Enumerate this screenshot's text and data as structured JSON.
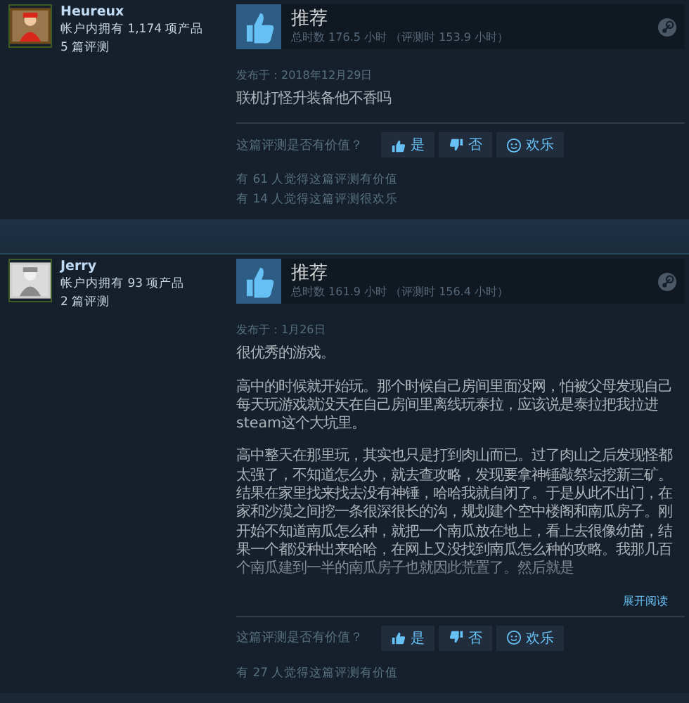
{
  "reviews": [
    {
      "author": "Heureux",
      "products": "帐户内拥有 1,174 项产品",
      "review_count": "5 篇评测",
      "recommended": true,
      "verdict": "推荐",
      "hours": "总时数 176.5 小时 （评测时 153.9 小时）",
      "posted": "发布于：2018年12月29日",
      "paragraphs": [
        "联机打怪升装备他不香吗"
      ],
      "truncated": false,
      "prompt": "这篇评测是否有价值？",
      "votes": [
        {
          "kind": "yes",
          "label": "是"
        },
        {
          "kind": "no",
          "label": "否"
        },
        {
          "kind": "funny",
          "label": "欢乐"
        }
      ],
      "stats": [
        "有 61 人觉得这篇评测有价值",
        "有 14 人觉得这篇评测很欢乐"
      ]
    },
    {
      "author": "Jerry",
      "products": "帐户内拥有 93 项产品",
      "review_count": "2 篇评测",
      "recommended": true,
      "verdict": "推荐",
      "hours": "总时数 161.9 小时 （评测时 156.4 小时）",
      "posted": "发布于：1月26日",
      "paragraphs": [
        "很优秀的游戏。",
        "高中的时候就开始玩。那个时候自己房间里面没网，怕被父母发现自己每天玩游戏就没天在自己房间里离线玩泰拉，应该说是泰拉把我拉进steam这个大坑里。",
        "高中整天在那里玩，其实也只是打到肉山而已。过了肉山之后发现怪都太强了，不知道怎么办，就去查攻略，发现要拿神锤敲祭坛挖新三矿。结果在家里找来找去没有神锤，哈哈我就自闭了。于是从此不出门，在家和沙漠之间挖一条很深很长的沟，规划建个空中楼阁和南瓜房子。刚开始不知道南瓜怎么种，就把一个南瓜放在地上，看上去很像幼苗，结果一个都没种出来哈哈，在网上又没找到南瓜怎么种的攻略。我那几百个南瓜建到一半的南瓜房子也就因此荒置了。然后就是"
      ],
      "truncated": true,
      "expand": "展开阅读",
      "prompt": "这篇评测是否有价值？",
      "votes": [
        {
          "kind": "yes",
          "label": "是"
        },
        {
          "kind": "no",
          "label": "否"
        },
        {
          "kind": "funny",
          "label": "欢乐"
        }
      ],
      "stats": [
        "有 27 人觉得这篇评测有价值"
      ]
    }
  ]
}
